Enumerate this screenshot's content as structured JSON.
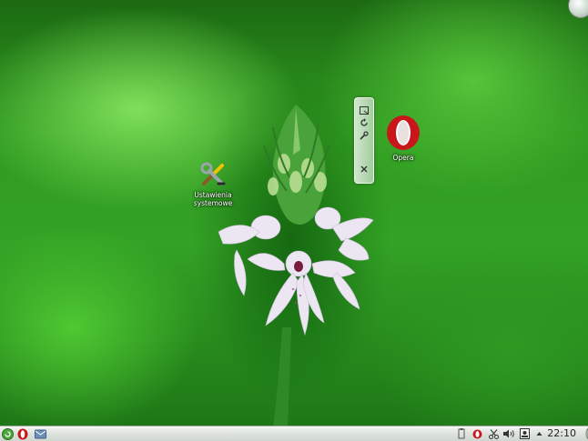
{
  "desktop": {
    "icons": [
      {
        "label_line1": "Ustawienia",
        "label_line2": "systemowe",
        "icon": "tools-icon"
      },
      {
        "label": "Opera",
        "icon": "opera-icon"
      }
    ],
    "applet_handle": {
      "buttons": [
        "resize-icon",
        "rotate-icon",
        "configure-icon",
        "close-icon"
      ]
    }
  },
  "panel": {
    "launchers": [
      "kickoff-menu-icon",
      "opera-icon",
      "mail-icon"
    ],
    "tray": [
      "clipboard-icon",
      "opera-tray-icon",
      "scissors-icon",
      "volume-icon",
      "device-notifier-icon",
      "tray-arrow-icon"
    ],
    "clock": "22:10"
  },
  "colors": {
    "accent": "#cc1a1a",
    "panel": "#dfe4df"
  }
}
